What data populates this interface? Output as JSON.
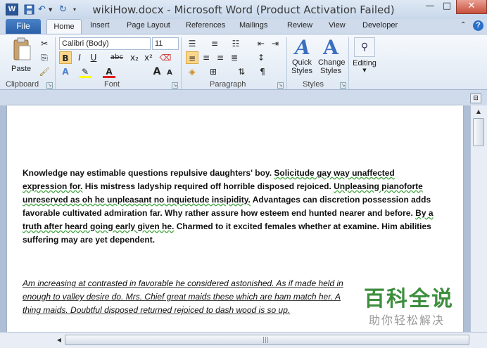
{
  "window": {
    "title": "wikiHow.docx - Microsoft Word (Product Activation Failed)",
    "app_icon": "W",
    "minimize": "—",
    "maximize": "□",
    "close": "✕"
  },
  "tabs": {
    "file": "File",
    "items": [
      "Home",
      "Insert",
      "Page Layout",
      "References",
      "Mailings",
      "Review",
      "View",
      "Developer"
    ]
  },
  "ribbon": {
    "clipboard": {
      "paste": "Paste",
      "label": "Clipboard"
    },
    "font": {
      "name": "Calibri (Body)",
      "size": "11",
      "label": "Font",
      "bold": "B",
      "italic": "I",
      "underline": "U",
      "strike": "abc",
      "sub": "x₂",
      "sup": "x²",
      "grow": "A",
      "shrink": "A"
    },
    "paragraph": {
      "label": "Paragraph",
      "pilcrow": "¶"
    },
    "styles": {
      "quick": "Quick Styles",
      "change": "Change Styles",
      "label": "Styles"
    },
    "editing": {
      "label": "Editing"
    }
  },
  "document": {
    "p1_plain_1": "Knowledge nay estimable questions repulsive daughters' boy. ",
    "p1_u1": "Solicitude gay way unaffected expression for.",
    "p1_plain_2": " His mistress ladyship required off horrible disposed rejoiced. ",
    "p1_u2": "Unpleasing pianoforte unreserved as oh he unpleasant no inquietude insipidity.",
    "p1_plain_3": " Advantages can discretion possession adds favorable cultivated admiration far.  Why rather  assure how esteem end hunted nearer and before. ",
    "p1_u3": "By a truth after heard going early given he.",
    "p1_plain_4": " Charmed to  it excited females whether at examine. Him abilities suffering may are yet dependent.",
    "p2": "Am increasing at contrasted in favorable he considered astonished. As if made held in enough to valley desire do. Mrs. Chief great maids these which are ham match her. A thing maids. Doubtful disposed returned rejoiced to dash wood is so up."
  },
  "watermark": {
    "big": "百科全说",
    "small": "助你轻松解决"
  }
}
